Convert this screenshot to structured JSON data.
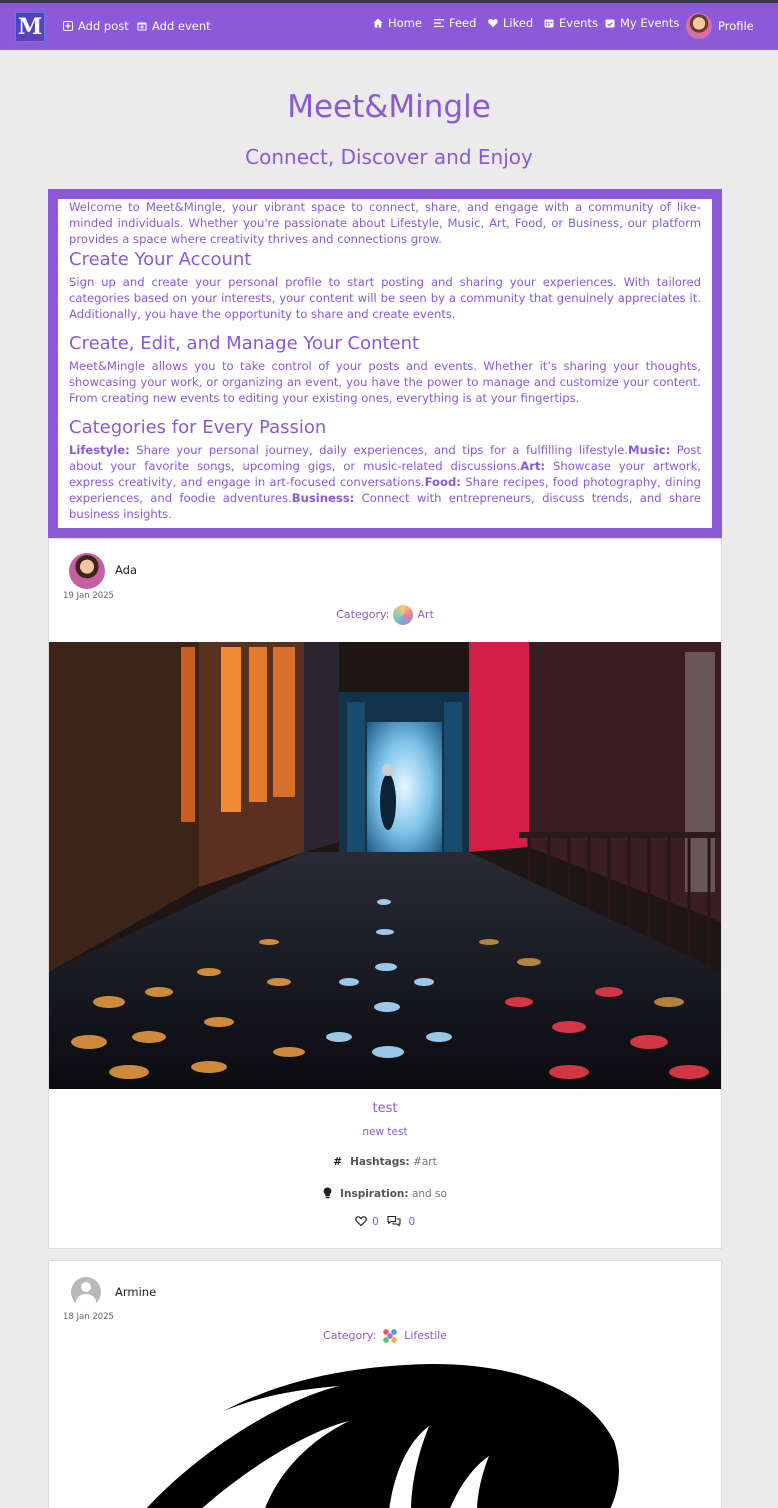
{
  "nav": {
    "logo_text": "M",
    "left_items": [
      {
        "label": "Add post",
        "icon": "plus-square-icon"
      },
      {
        "label": "Add event",
        "icon": "calendar-plus-icon"
      }
    ],
    "right_items": [
      {
        "label": "Home",
        "icon": "home-icon"
      },
      {
        "label": "Feed",
        "icon": "list-icon"
      },
      {
        "label": "Liked",
        "icon": "heart-icon"
      },
      {
        "label": "Events",
        "icon": "calendar-icon"
      },
      {
        "label": "My Events",
        "icon": "calendar-check-icon"
      },
      {
        "label": "Profile",
        "icon": "avatar"
      }
    ]
  },
  "hero": {
    "title": "Meet&Mingle",
    "subtitle": "Connect, Discover and Enjoy"
  },
  "intro": {
    "welcome": "Welcome to Meet&Mingle, your vibrant space to connect, share, and engage with a community of like-minded individuals. Whether you're passionate about Lifestyle, Music, Art, Food, or Business, our platform provides a space where creativity thrives and connections grow.",
    "sections": [
      {
        "heading": "Create Your Account",
        "text": "Sign up and create your personal profile to start posting and sharing your experiences. With tailored categories based on your interests, your content will be seen by a community that genuinely appreciates it. Additionally, you have the opportunity to share and create events."
      },
      {
        "heading": "Create, Edit, and Manage Your Content",
        "text": "Meet&Mingle allows you to take control of your posts and events. Whether it’s sharing your thoughts, showcasing your work, or organizing an event, you have the power to manage and customize your content. From creating new events to editing your existing ones, everything is at your fingertips."
      },
      {
        "heading": "Categories for Every Passion"
      }
    ],
    "categories": [
      {
        "name": "Lifestyle:",
        "text": " Share your personal journey, daily experiences, and tips for a fulfilling lifestyle."
      },
      {
        "name": "Music:",
        "text": " Post about your favorite songs, upcoming gigs, or music-related discussions."
      },
      {
        "name": "Art:",
        "text": " Showcase your artwork, express creativity, and engage in art-focused conversations."
      },
      {
        "name": "Food:",
        "text": " Share recipes, food photography, dining experiences, and foodie adventures."
      },
      {
        "name": "Business:",
        "text": " Connect with entrepreneurs, discuss trends, and share business insights."
      }
    ]
  },
  "posts": [
    {
      "user": "Ada",
      "date": "19 Jan 2025",
      "category_label": "Category:",
      "category": "Art",
      "title": "test",
      "description": "new test",
      "hashtags_label": "Hashtags:",
      "hashtags": "#art",
      "inspiration_label": "Inspiration:",
      "inspiration": "and so",
      "likes": "0",
      "comments": "0"
    },
    {
      "user": "Armine",
      "date": "18 Jan 2025",
      "category_label": "Category:",
      "category": "Lifestile"
    }
  ],
  "colors": {
    "accent": "#8c5ad8",
    "background": "#ebebeb"
  }
}
